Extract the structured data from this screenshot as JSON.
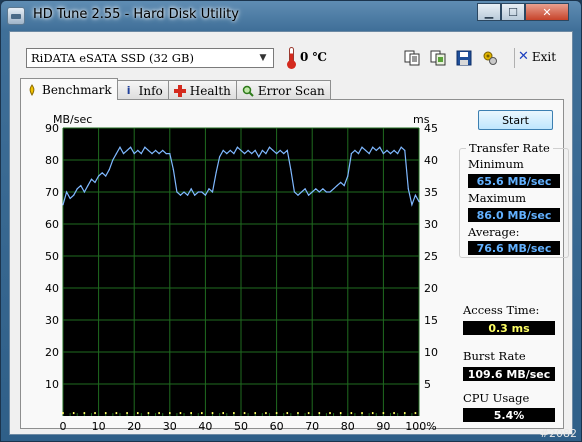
{
  "window": {
    "title": "HD Tune 2.55 - Hard Disk Utility",
    "controls": [
      "minimize",
      "maximize",
      "close"
    ]
  },
  "toolbar": {
    "drive": "RiDATA  eSATA SSD (32 GB)",
    "temperature": "0 ℃",
    "buttons": [
      "copy-icon",
      "copy-screenshot-icon",
      "save-icon",
      "options-icon"
    ],
    "exit_label": "Exit"
  },
  "tabs": [
    {
      "label": "Benchmark",
      "icon": "benchmark-icon",
      "active": true
    },
    {
      "label": "Info",
      "icon": "info-icon",
      "active": false
    },
    {
      "label": "Health",
      "icon": "health-icon",
      "active": false
    },
    {
      "label": "Error Scan",
      "icon": "error-scan-icon",
      "active": false
    }
  ],
  "start_label": "Start",
  "results": {
    "group_title": "Transfer Rate",
    "minimum_label": "Minimum",
    "minimum": "65.6 MB/sec",
    "maximum_label": "Maximum",
    "maximum": "86.0 MB/sec",
    "average_label": "Average:",
    "average": "76.6 MB/sec",
    "access_label": "Access Time:",
    "access": "0.3 ms",
    "burst_label": "Burst Rate",
    "burst": "109.6 MB/sec",
    "cpu_label": "CPU Usage",
    "cpu": "5.4%"
  },
  "watermark": "#2082",
  "colors": {
    "plot_background": "#000000",
    "grid": "#1f6b1f",
    "transfer_line": "#7fb8ff",
    "access_marks": "#ffff66"
  },
  "chart_data": {
    "type": "line",
    "ylabel": "MB/sec",
    "y2label": "ms",
    "ylim": [
      0,
      90
    ],
    "y2lim": [
      0,
      45
    ],
    "yticks": [
      10,
      20,
      30,
      40,
      50,
      60,
      70,
      80,
      90
    ],
    "y2ticks": [
      5,
      10,
      15,
      20,
      25,
      30,
      35,
      40,
      45
    ],
    "xticks": [
      "0",
      "10",
      "20",
      "30",
      "40",
      "50",
      "60",
      "70",
      "80",
      "90",
      "100%"
    ],
    "xlim": [
      0,
      100
    ],
    "grid": true,
    "series": [
      {
        "axis": "left",
        "x": [
          0,
          1,
          2,
          3,
          4,
          5,
          6,
          7,
          8,
          9,
          10,
          11,
          12,
          13,
          14,
          15,
          16,
          17,
          18,
          19,
          20,
          21,
          22,
          23,
          24,
          25,
          26,
          27,
          28,
          29,
          30,
          31,
          32,
          33,
          34,
          35,
          36,
          37,
          38,
          39,
          40,
          41,
          42,
          43,
          44,
          45,
          46,
          47,
          48,
          49,
          50,
          51,
          52,
          53,
          54,
          55,
          56,
          57,
          58,
          59,
          60,
          61,
          62,
          63,
          64,
          65,
          66,
          67,
          68,
          69,
          70,
          71,
          72,
          73,
          74,
          75,
          76,
          77,
          78,
          79,
          80,
          81,
          82,
          83,
          84,
          85,
          86,
          87,
          88,
          89,
          90,
          91,
          92,
          93,
          94,
          95,
          96,
          97,
          98,
          99,
          100
        ],
        "y": [
          66,
          70,
          68,
          69,
          71,
          72,
          70,
          72,
          74,
          73,
          75,
          76,
          75,
          77,
          80,
          82,
          84,
          82,
          83,
          84,
          82,
          83,
          82,
          84,
          83,
          82,
          83,
          82,
          83,
          82,
          82,
          77,
          70,
          69,
          70,
          69,
          71,
          69,
          70,
          70,
          69,
          71,
          70,
          76,
          81,
          83,
          82,
          83,
          82,
          84,
          83,
          82,
          83,
          82,
          83,
          81,
          83,
          82,
          84,
          83,
          82,
          83,
          82,
          83,
          77,
          70,
          69,
          70,
          71,
          69,
          70,
          71,
          70,
          71,
          70,
          70,
          71,
          72,
          73,
          72,
          75,
          82,
          83,
          82,
          84,
          83,
          82,
          84,
          83,
          84,
          82,
          83,
          82,
          83,
          82,
          84,
          83,
          71,
          66,
          69,
          67
        ]
      },
      {
        "axis": "right",
        "x": [
          0,
          1,
          2,
          3,
          4,
          5,
          6,
          7,
          8,
          9,
          10,
          11,
          12,
          13,
          14,
          15,
          16,
          17,
          18,
          19,
          20,
          21,
          22,
          23,
          24,
          25,
          26,
          27,
          28,
          29,
          30,
          31,
          32,
          33,
          34,
          35,
          36,
          37,
          38,
          39,
          40,
          41,
          42,
          43,
          44,
          45,
          46,
          47,
          48,
          49,
          50,
          51,
          52,
          53,
          54,
          55,
          56,
          57,
          58,
          59,
          60,
          61,
          62,
          63,
          64,
          65,
          66,
          67,
          68,
          69,
          70,
          71,
          72,
          73,
          74,
          75,
          76,
          77,
          78,
          79,
          80,
          81,
          82,
          83,
          84,
          85,
          86,
          87,
          88,
          89,
          90,
          91,
          92,
          93,
          94,
          95,
          96,
          97,
          98,
          99,
          100
        ],
        "y": [
          0.3,
          0.3,
          0.3,
          0.3,
          0.3,
          0.3,
          0.3,
          0.3,
          0.3,
          0.3,
          0.3,
          0.3,
          0.3,
          0.3,
          0.3,
          0.3,
          0.3,
          0.3,
          0.3,
          0.3,
          0.3,
          0.3,
          0.3,
          0.3,
          0.3,
          0.3,
          0.3,
          0.3,
          0.3,
          0.3,
          0.3,
          0.3,
          0.3,
          0.3,
          0.3,
          0.3,
          0.3,
          0.3,
          0.3,
          0.3,
          0.3,
          0.3,
          0.3,
          0.3,
          0.3,
          0.3,
          0.3,
          0.3,
          0.3,
          0.3,
          0.3,
          0.3,
          0.3,
          0.3,
          0.3,
          0.3,
          0.3,
          0.3,
          0.3,
          0.3,
          0.3,
          0.3,
          0.3,
          0.3,
          0.3,
          0.3,
          0.3,
          0.3,
          0.3,
          0.3,
          0.3,
          0.3,
          0.3,
          0.3,
          0.3,
          0.3,
          0.3,
          0.3,
          0.3,
          0.3,
          0.3,
          0.3,
          0.3,
          0.3,
          0.3,
          0.3,
          0.3,
          0.3,
          0.3,
          0.3,
          0.3,
          0.3,
          0.3,
          0.3,
          0.3,
          0.3,
          0.3,
          0.3,
          0.3,
          0.3,
          0.3
        ]
      }
    ]
  }
}
